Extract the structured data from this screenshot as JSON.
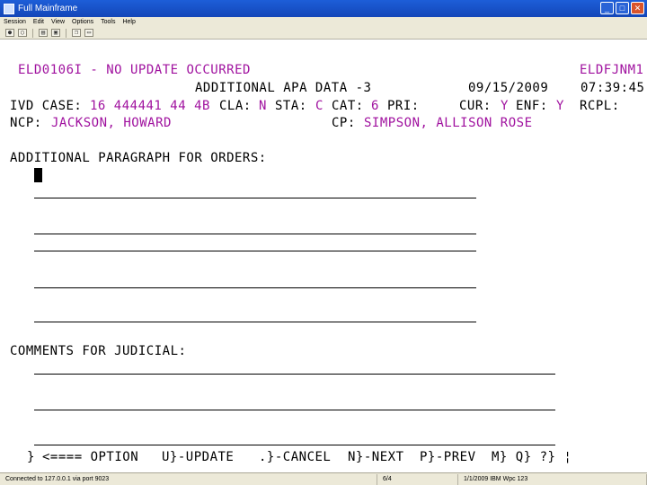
{
  "window": {
    "title": "Full Mainframe",
    "minimize": "_",
    "maximize": "□",
    "close": "✕"
  },
  "menu": [
    "Session",
    "Edit",
    "View",
    "Options",
    "Tools",
    "Help"
  ],
  "screen": {
    "message": "ELD0106I - NO UPDATE OCCURRED",
    "screen_id": "ELDFJNM1",
    "screen_title": "ADDITIONAL APA DATA -3",
    "date": "09/15/2009",
    "time": "07:39:45",
    "ivd_case_label": "IVD CASE:",
    "ivd_case_value": "16 444441 44 4B",
    "cla_label": "CLA:",
    "cla_value": "N",
    "sta_label": "STA:",
    "sta_value": "C",
    "cat_label": "CAT:",
    "cat_value": "6",
    "pri_label": "PRI:",
    "cur_label": "CUR:",
    "cur_value": "Y",
    "enf_label": "ENF:",
    "enf_value": "Y",
    "rcpl_label": "RCPL:",
    "ncp_label": "NCP:",
    "ncp_value": "JACKSON, HOWARD",
    "cp_label": "CP:",
    "cp_value": "SIMPSON, ALLISON ROSE",
    "orders_label": "ADDITIONAL PARAGRAPH FOR ORDERS:",
    "judicial_label": "COMMENTS FOR JUDICIAL:",
    "option_prompt": "<==== OPTION",
    "pf_update": "U}-UPDATE",
    "pf_cancel": ".}-CANCEL",
    "pf_next": "N}-NEXT",
    "pf_prev": "P}-PREV",
    "pf_tail": "M} Q} ?} ¦"
  },
  "status": {
    "connection": "Connected to 127.0.0.1 via port 9023",
    "cursor_pos": "6/4",
    "info": "1/1/2009 IBM Wpc 123"
  },
  "colors": {
    "protected_field": "#000000",
    "data_field": "#a0129f"
  }
}
